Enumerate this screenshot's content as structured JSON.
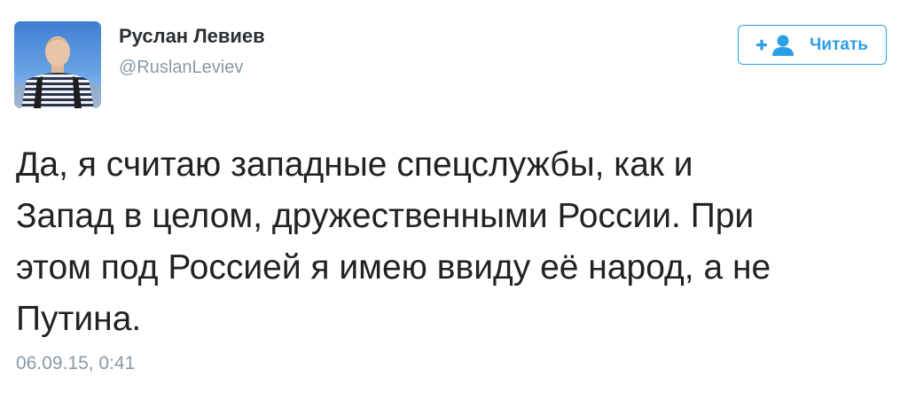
{
  "author": {
    "name": "Руслан Левиев",
    "handle": "@RuslanLeviev"
  },
  "follow_button": {
    "icon": "add-user-icon",
    "label": "Читать",
    "color": "#2b9fe6"
  },
  "tweet": {
    "lines": [
      "Да, я считаю западные спецслужбы, как и",
      "Запад в целом, дружественными России. При",
      "этом под Россией я имею ввиду её народ, а не",
      "Путина."
    ],
    "timestamp": "06.09.15, 0:41"
  }
}
